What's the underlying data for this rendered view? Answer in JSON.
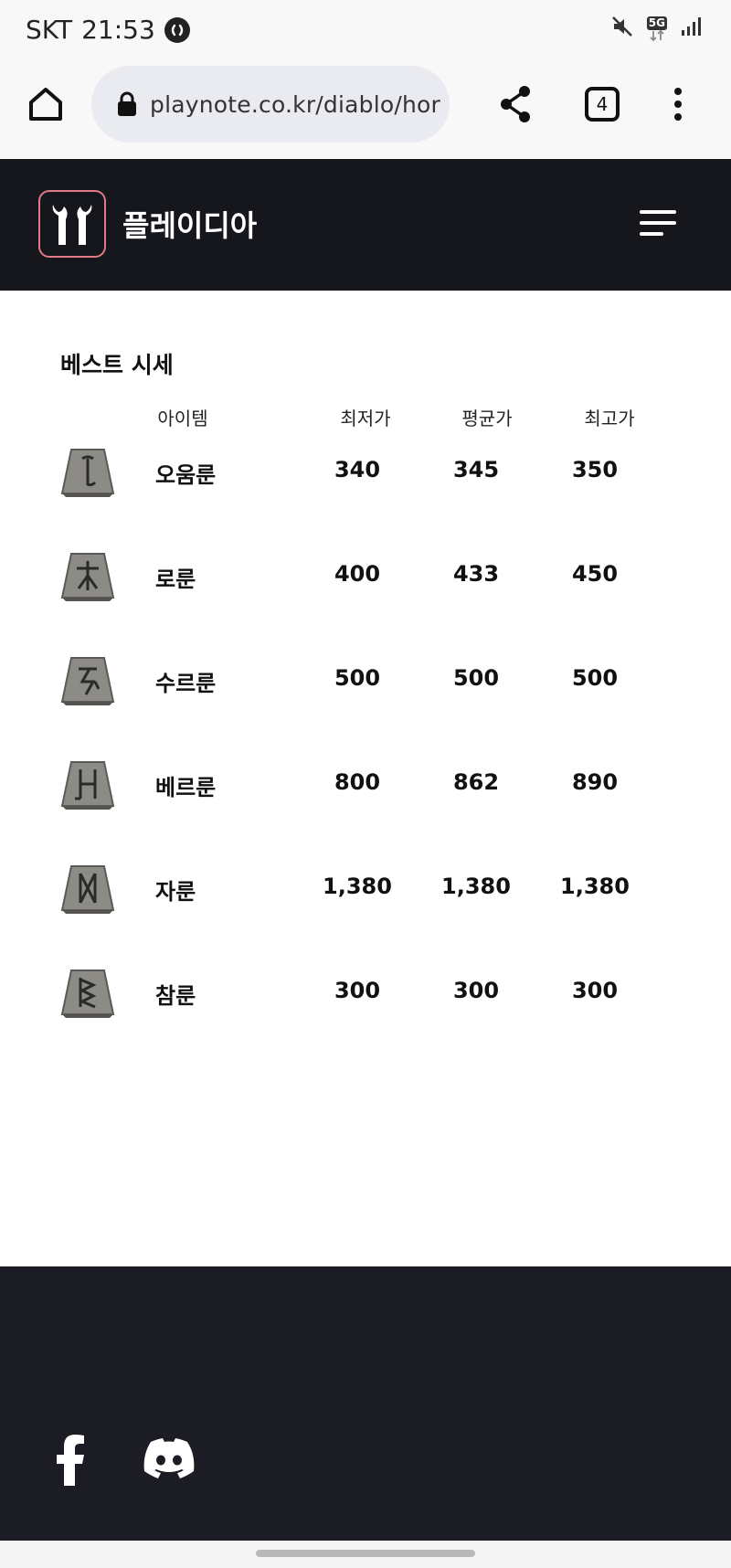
{
  "status_bar": {
    "carrier": "SKT",
    "time": "21:53",
    "network": "5G"
  },
  "browser": {
    "url": "playnote.co.kr/diablo/hor",
    "tab_count": "4"
  },
  "site": {
    "name": "플레이디아"
  },
  "best_prices": {
    "title": "베스트 시세",
    "columns": [
      "아이템",
      "최저가",
      "평균가",
      "최고가"
    ],
    "rows": [
      {
        "name": "오움룬",
        "min": "340",
        "avg": "345",
        "max": "350"
      },
      {
        "name": "로룬",
        "min": "400",
        "avg": "433",
        "max": "450"
      },
      {
        "name": "수르룬",
        "min": "500",
        "avg": "500",
        "max": "500"
      },
      {
        "name": "베르룬",
        "min": "800",
        "avg": "862",
        "max": "890"
      },
      {
        "name": "자룬",
        "min": "1,380",
        "avg": "1,380",
        "max": "1,380"
      },
      {
        "name": "참룬",
        "min": "300",
        "avg": "300",
        "max": "300"
      }
    ]
  },
  "colors": {
    "header_bg": "#15171c",
    "footer_bg": "#1b1c24",
    "logo_border": "#e07b86"
  }
}
